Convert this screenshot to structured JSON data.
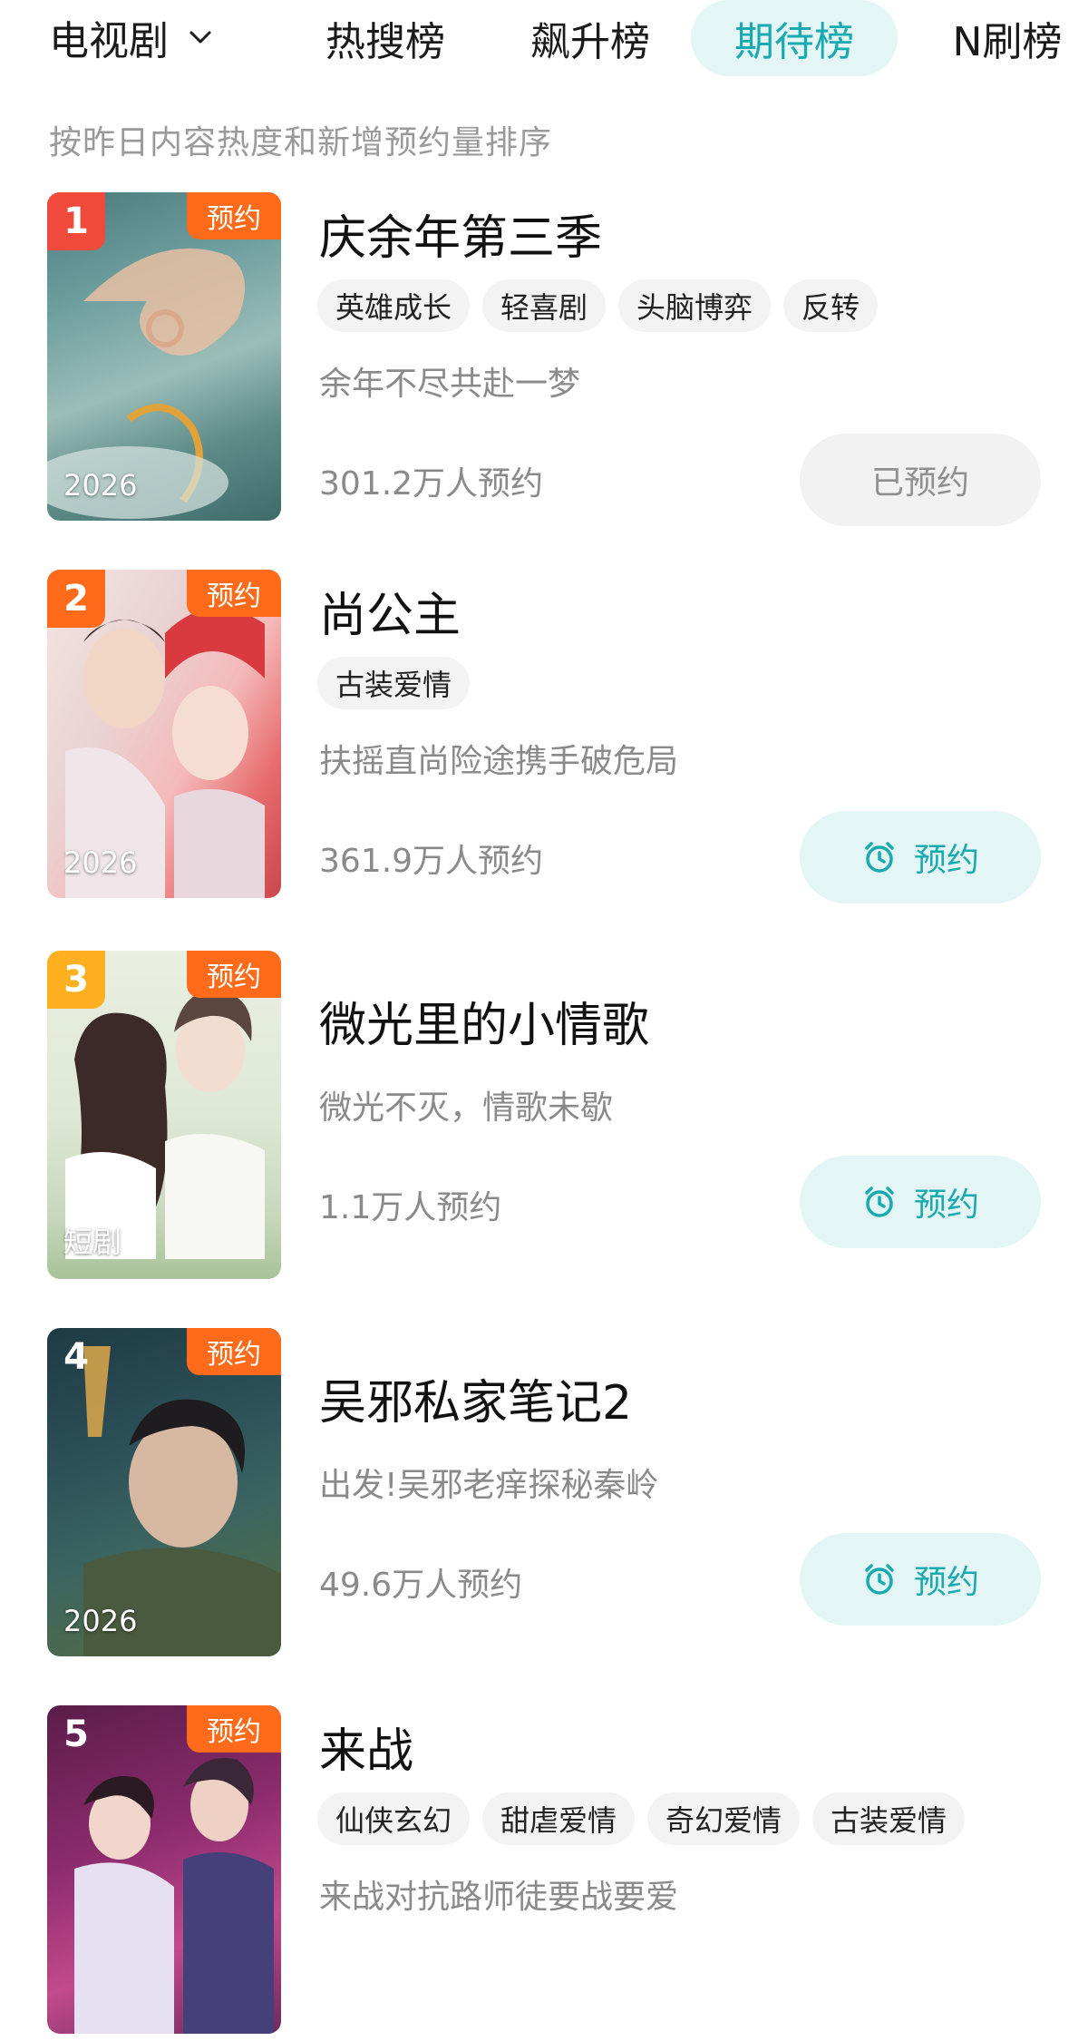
{
  "category": {
    "label": "电视剧",
    "icon": "chevron-down-icon"
  },
  "tabs": [
    {
      "label": "热搜榜",
      "active": false
    },
    {
      "label": "飙升榜",
      "active": false
    },
    {
      "label": "期待榜",
      "active": true
    },
    {
      "label": "N刷榜",
      "active": false
    }
  ],
  "subtitle": "按昨日内容热度和新增预约量排序",
  "colors": {
    "accent": "#18aab0",
    "accent_bg": "#e3f6f5",
    "reserve_tag": "#ff6b1a",
    "rank_1": "#f04a3c",
    "rank_2": "#ff6b1a",
    "rank_3": "#ffb020",
    "rank_other": "transparent"
  },
  "items": [
    {
      "rank": "1",
      "reserve_tag": "预约",
      "poster_caption": "2026",
      "title": "庆余年第三季",
      "tags": [
        "英雄成长",
        "轻喜剧",
        "头脑博弈",
        "反转"
      ],
      "desc": "余年不尽共赴一梦",
      "count": "301.2万人预约",
      "button": {
        "label": "已预约",
        "state": "reserved",
        "icon": ""
      }
    },
    {
      "rank": "2",
      "reserve_tag": "预约",
      "poster_caption": "2026",
      "title": "尚公主",
      "tags": [
        "古装爱情"
      ],
      "desc": "扶摇直尚险途携手破危局",
      "count": "361.9万人预约",
      "button": {
        "label": "预约",
        "state": "reserve",
        "icon": "alarm-clock-icon"
      }
    },
    {
      "rank": "3",
      "reserve_tag": "预约",
      "poster_caption": "短剧",
      "title": "微光里的小情歌",
      "tags": [],
      "desc": "微光不灭，情歌未歇",
      "count": "1.1万人预约",
      "button": {
        "label": "预约",
        "state": "reserve",
        "icon": "alarm-clock-icon"
      }
    },
    {
      "rank": "4",
      "reserve_tag": "预约",
      "poster_caption": "2026",
      "title": "吴邪私家笔记2",
      "tags": [],
      "desc": "出发!吴邪老痒探秘秦岭",
      "count": "49.6万人预约",
      "button": {
        "label": "预约",
        "state": "reserve",
        "icon": "alarm-clock-icon"
      }
    },
    {
      "rank": "5",
      "reserve_tag": "预约",
      "poster_caption": "",
      "title": "来战",
      "tags": [
        "仙侠玄幻",
        "甜虐爱情",
        "奇幻爱情",
        "古装爱情"
      ],
      "desc": "来战对抗路师徒要战要爱",
      "count": "",
      "button": null
    }
  ]
}
